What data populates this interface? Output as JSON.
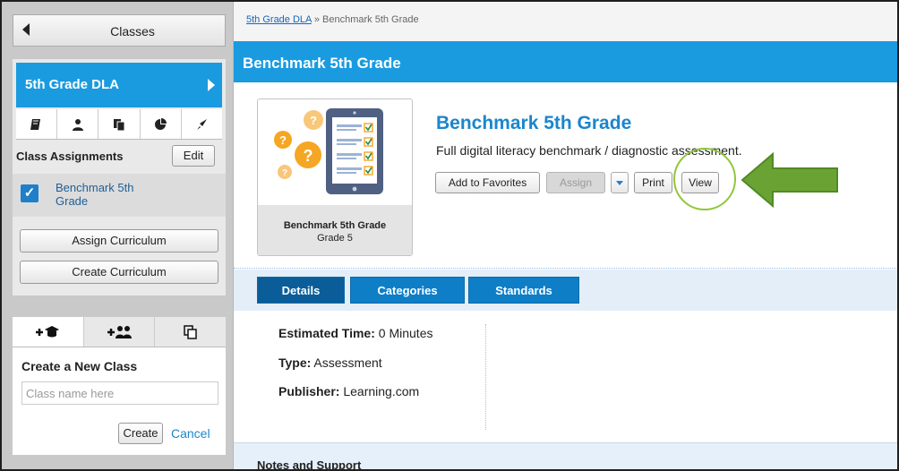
{
  "sidebar": {
    "top_label": "Classes",
    "class_name": "5th Grade DLA",
    "icon_tabs": [
      "book-icon",
      "user-icon",
      "copy-icon",
      "pie-chart-icon",
      "rocket-icon"
    ],
    "assignments_title": "Class Assignments",
    "edit_label": "Edit",
    "assignment_label": "Benchmark 5th Grade",
    "assign_curriculum_label": "Assign Curriculum",
    "create_curriculum_label": "Create Curriculum",
    "new_class": {
      "tabs": [
        "add-class-icon",
        "add-students-icon",
        "copy-class-icon"
      ],
      "title": "Create a New Class",
      "placeholder": "Class name here",
      "create_label": "Create",
      "cancel_label": "Cancel"
    }
  },
  "main": {
    "breadcrumb": {
      "parent": "5th Grade DLA",
      "sep": " » ",
      "current": "Benchmark 5th Grade"
    },
    "header_title": "Benchmark 5th Grade",
    "card": {
      "title": "Benchmark 5th Grade",
      "grade": "Grade 5"
    },
    "title": "Benchmark 5th Grade",
    "description": "Full digital literacy benchmark / diagnostic assessment.",
    "buttons": {
      "favorites": "Add to Favorites",
      "assign": "Assign",
      "print": "Print",
      "view": "View"
    },
    "tabs": [
      "Details",
      "Categories",
      "Standards"
    ],
    "details": [
      {
        "label": "Estimated Time:",
        "value": " 0 Minutes"
      },
      {
        "label": "Type:",
        "value": " Assessment"
      },
      {
        "label": "Publisher:",
        "value": " Learning.com"
      }
    ],
    "notes_title": "Notes and Support"
  },
  "colors": {
    "brand_blue": "#1a9be0",
    "highlight_green": "#91c63c",
    "arrow_green": "#6aa333"
  }
}
